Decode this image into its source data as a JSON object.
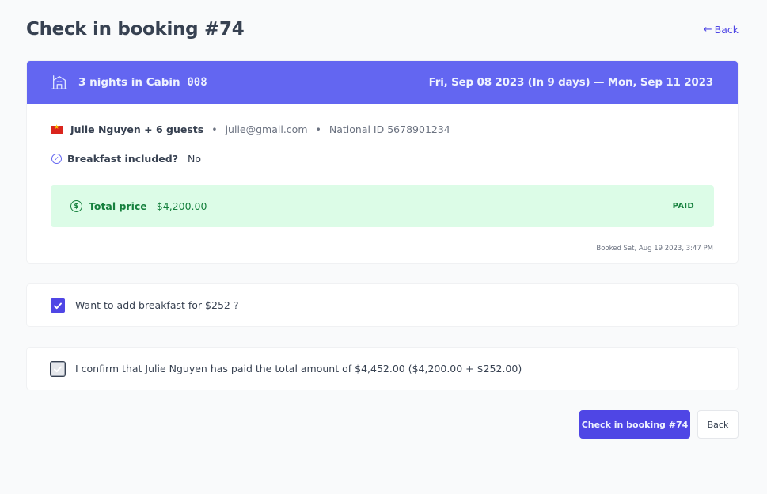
{
  "header": {
    "title": "Check in booking #74",
    "back_label": "Back",
    "back_arrow": "←"
  },
  "booking": {
    "banner": {
      "icon": "house-icon",
      "nights": "3 nights in Cabin",
      "cabin_code": "008",
      "dates": "Fri, Sep 08 2023 (In 9 days) — Mon, Sep 11 2023"
    },
    "guest": {
      "flag": "vietnam-flag",
      "name": "Julie Nguyen + 6 guests",
      "email": "julie@gmail.com",
      "national_id": "National ID 5678901234",
      "separator": "•"
    },
    "breakfast": {
      "label": "Breakfast included?",
      "value": "No"
    },
    "price": {
      "label": "Total price",
      "value": "$4,200.00",
      "status": "PAID"
    },
    "booked_at": "Booked Sat, Aug 19 2023, 3:47 PM"
  },
  "options": {
    "add_breakfast": {
      "label": "Want to add breakfast for $252 ?",
      "checked": true
    },
    "confirm_paid": {
      "label": "I confirm that Julie Nguyen has paid the total amount of $4,452.00 ($4,200.00 + $252.00)",
      "checked": true,
      "disabled": true
    }
  },
  "actions": {
    "checkin_label": "Check in booking #74",
    "back_label": "Back"
  },
  "colors": {
    "brand": "#4f46e5",
    "banner": "#6366f1",
    "success_bg": "#dcfce7",
    "success_text": "#15803d"
  }
}
